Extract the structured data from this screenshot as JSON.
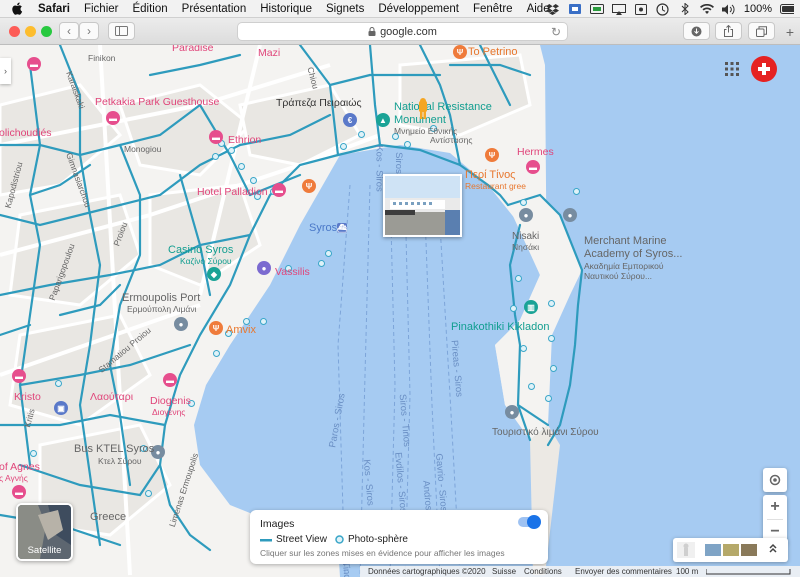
{
  "menubar": {
    "app": "Safari",
    "items": [
      "Fichier",
      "Édition",
      "Présentation",
      "Historique",
      "Signets",
      "Développement",
      "Fenêtre",
      "Aide"
    ],
    "battery": "100%"
  },
  "toolbar": {
    "url": "google.com"
  },
  "map": {
    "labels": {
      "paradise": "Paradise",
      "mazi": "Mazi",
      "to_petrino": "To Petrino",
      "finikon": "Finikon",
      "karaiskaki": "Karaiskaki",
      "chiou": "Chiou",
      "petkakia": "Petkakia Park Guesthouse",
      "trapeza": "Τράπεζα Πειραιώς",
      "national_resistance_1": "National Resistance",
      "national_resistance_2": "Monument",
      "national_resistance_sub": "Μνημείο Εθνικής",
      "national_resistance_sub2": "Αντίστασης",
      "oichoudies": "olichoudiés",
      "ethrion": "Ethrion",
      "monogiou": "Monogiou",
      "hermes": "Hermes",
      "gimnasiarchou": "Gimnasiarchou",
      "kapodistriou": "Kapodistriou",
      "hotel_palladion": "Hotel Palladion",
      "peri_tinos": "Περί Τίνος",
      "peri_tinos_sub": "Restaurant gree",
      "proiou": "Proiou",
      "syros": "Syros",
      "nisaki": "Nisaki",
      "nisaki_sub": "Νησάκι",
      "merchant_1": "Merchant Marine",
      "merchant_2": "Academy of Syros...",
      "merchant_sub1": "Ακαδημία Εμπορικού",
      "merchant_sub2": "Ναυτικού Σύρου...",
      "paparigopoulou": "Paparigopoulou",
      "casino": "Casino Syros",
      "casino_sub": "Καζίνο Σύρου",
      "vassilis": "Vassilis",
      "ermoupolis_port": "Ermoupolis Port",
      "ermoupolis_port_sub": "Ερμούπολη Λιμάνι",
      "amvix": "Amvix",
      "pinakothiki": "Pinakothiki Kikladon",
      "stamatiou_proiou": "Stamatiou Proiou",
      "kristo": "Kristo",
      "lagkatari": "Λαούταρι",
      "diogenis": "Diogenis",
      "diogenis_sub": "Διογένης",
      "kritis": "Kritis",
      "tourist_port": "Τουριστικό λιμάνι Σύρου",
      "bus_ktel": "Bus KTEL Syros",
      "bus_ktel_sub": "Κτελ Σύρου",
      "of_agnes": "of Agnes",
      "of_agnes_sub": "ς Αγνής",
      "limenas": "Limenas Ermoupolis",
      "greece": "Greece",
      "kos_siros_top": "Kos - Siros",
      "siros_tinos_top": "Siros - Tinos",
      "paros_siros": "Paros - Siros",
      "siros_tinos": "Siros - Tinos",
      "kos_siros": "Kos - Siros",
      "evdilos": "Evdilos - Siros",
      "gavrio": "Gavrio - Siros",
      "andros": "Andros",
      "pireas_siros": "Pireas - Siros",
      "tino": "Tino"
    }
  },
  "satellite": {
    "label": "Satellite"
  },
  "images_panel": {
    "title": "Images",
    "street_view": "Street View",
    "photo_sphere": "Photo-sphère",
    "description": "Cliquer sur les zones mises en évidence pour afficher les images"
  },
  "footer": {
    "data": "Données cartographiques ©2020",
    "country": "Suisse",
    "conditions": "Conditions",
    "feedback": "Envoyer des commentaires",
    "scale": "100 m"
  },
  "colors": {
    "water": "#a6cbf2",
    "land": "#f4f3f1",
    "street_view": "#2e9bbd",
    "profile": "#e52222"
  }
}
